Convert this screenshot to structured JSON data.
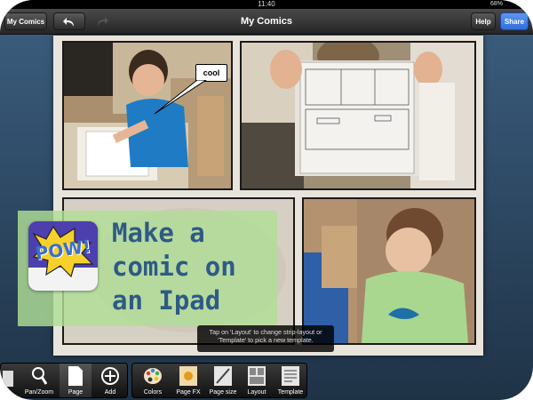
{
  "statusbar": {
    "time": "11:40",
    "battery": "68%"
  },
  "navbar": {
    "left_button": "My Comics",
    "title": "My Comics",
    "help_button": "Help",
    "share_button": "Share"
  },
  "comic": {
    "speech_bubble": "cool"
  },
  "overlay": {
    "line1": "Make a",
    "line2": "comic on",
    "line3": "an Ipad",
    "logo_text": "POW!"
  },
  "tooltip": {
    "text": "Tap on 'Layout' to change strip-layout or 'Template' to pick a new template."
  },
  "toolbar": {
    "pan_zoom": "Pan/Zoom",
    "page": "Page",
    "add": "Add",
    "colors": "Colors",
    "page_fx": "Page FX",
    "page_size": "Page size",
    "layout": "Layout",
    "template": "Template"
  },
  "colors": {
    "share": "#2f6fe0",
    "overlay_text": "#2e5a86",
    "overlay_bg": "#b0de96"
  }
}
